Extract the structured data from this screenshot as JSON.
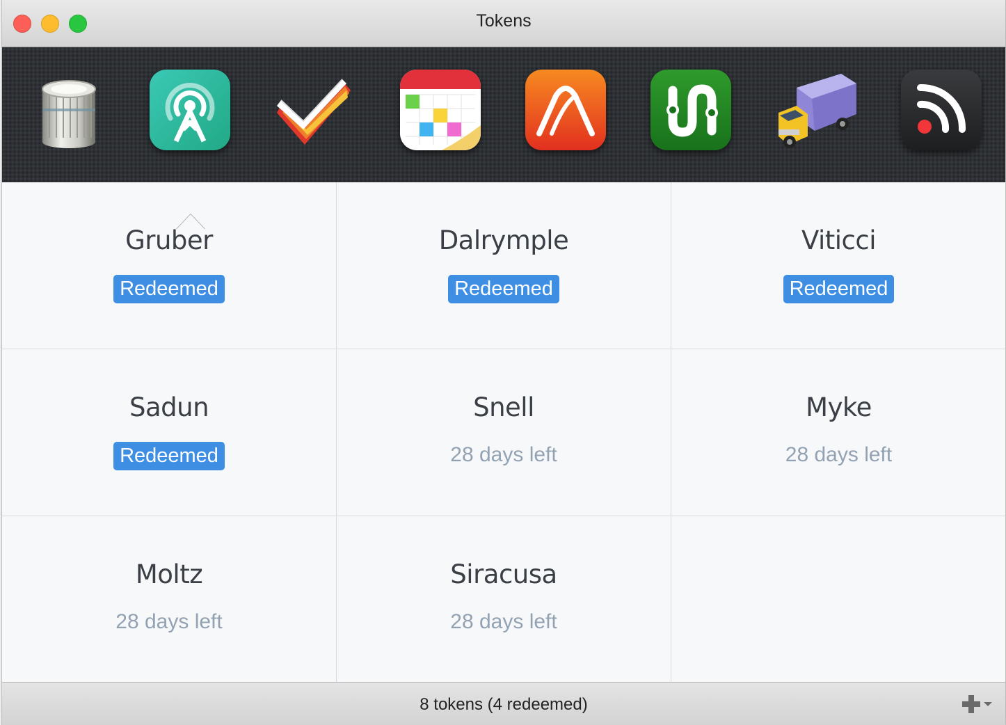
{
  "window": {
    "title": "Tokens"
  },
  "toolbar": {
    "apps": [
      {
        "name": "database-app-icon"
      },
      {
        "name": "overcast-app-icon"
      },
      {
        "name": "clear-todo-app-icon"
      },
      {
        "name": "fantastical-calendar-app-icon"
      },
      {
        "name": "vesper-app-icon"
      },
      {
        "name": "transit-app-icon"
      },
      {
        "name": "transmit-truck-app-icon"
      },
      {
        "name": "rss-reader-app-icon"
      }
    ],
    "selected_index": 1
  },
  "tokens": [
    {
      "name": "Gruber",
      "status": "Redeemed",
      "redeemed": true
    },
    {
      "name": "Dalrymple",
      "status": "Redeemed",
      "redeemed": true
    },
    {
      "name": "Viticci",
      "status": "Redeemed",
      "redeemed": true
    },
    {
      "name": "Sadun",
      "status": "Redeemed",
      "redeemed": true
    },
    {
      "name": "Snell",
      "status": "28 days left",
      "redeemed": false
    },
    {
      "name": "Myke",
      "status": "28 days left",
      "redeemed": false
    },
    {
      "name": "Moltz",
      "status": "28 days left",
      "redeemed": false
    },
    {
      "name": "Siracusa",
      "status": "28 days left",
      "redeemed": false
    }
  ],
  "footer": {
    "summary": "8 tokens (4 redeemed)"
  },
  "colors": {
    "badge": "#3e8ee4",
    "muted_text": "#93a2b3"
  }
}
